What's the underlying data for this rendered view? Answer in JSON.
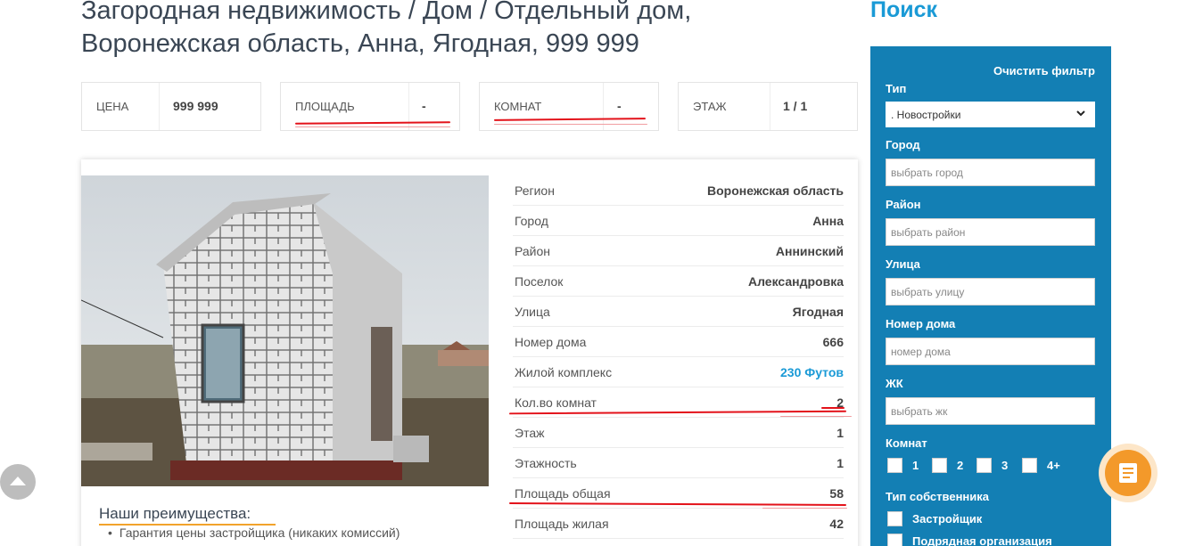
{
  "page": {
    "title_line1": "Загородная недвижимость / Дом / Отдельный дом,",
    "title_line2": "Воронежская область, Анна, Ягодная, 999 999"
  },
  "stats": [
    {
      "label": "ЦЕНА",
      "value": "999 999"
    },
    {
      "label": "ПЛОЩАДЬ",
      "value": "-"
    },
    {
      "label": "КОМНАТ",
      "value": "-"
    },
    {
      "label": "ЭТАЖ",
      "value": "1 / 1"
    }
  ],
  "properties": [
    {
      "key": "Регион",
      "value": "Воронежская область"
    },
    {
      "key": "Город",
      "value": "Анна"
    },
    {
      "key": "Район",
      "value": "Аннинский"
    },
    {
      "key": "Поселок",
      "value": "Александровка"
    },
    {
      "key": "Улица",
      "value": "Ягодная"
    },
    {
      "key": "Номер дома",
      "value": "666"
    },
    {
      "key": "Жилой комплекс",
      "value": "230 Футов"
    },
    {
      "key": "Кол.во комнат",
      "value": "2"
    },
    {
      "key": "Этаж",
      "value": "1"
    },
    {
      "key": "Этажность",
      "value": "1"
    },
    {
      "key": "Площадь общая",
      "value": "58"
    },
    {
      "key": "Площадь жилая",
      "value": "42"
    }
  ],
  "advantages": {
    "title": "Наши преимущества:",
    "items": [
      "Гарантия цены застройщика (никаких комиссий)"
    ]
  },
  "search": {
    "title": "Поиск",
    "clear_filter": "Очистить фильтр",
    "type_label": "Тип",
    "type_value": ". Новостройки",
    "city_label": "Город",
    "city_placeholder": "выбрать город",
    "district_label": "Район",
    "district_placeholder": "выбрать район",
    "street_label": "Улица",
    "street_placeholder": "выбрать улицу",
    "house_label": "Номер дома",
    "house_placeholder": "номер дома",
    "complex_label": "ЖК",
    "complex_placeholder": "выбрать жк",
    "rooms_label": "Комнат",
    "rooms": [
      "1",
      "2",
      "3",
      "4+"
    ],
    "owner_label": "Тип собственника",
    "owners": [
      "Застройщик",
      "Подрядная организация"
    ]
  },
  "colors": {
    "accent": "#1a9ad6",
    "panel": "#137fb4",
    "orange": "#f3992a",
    "annotation_red": "#e3121a"
  }
}
